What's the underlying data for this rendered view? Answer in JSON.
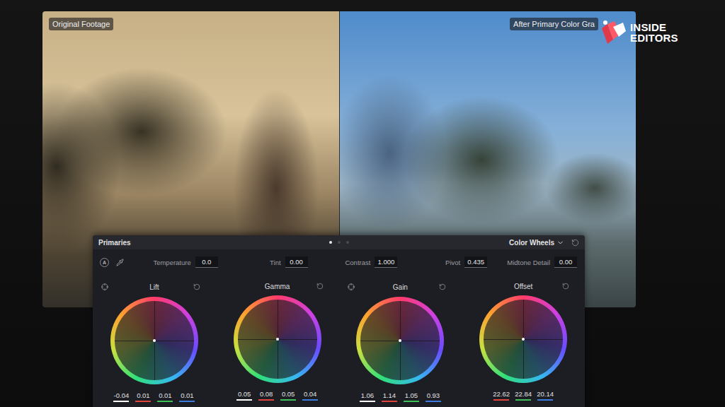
{
  "video": {
    "labels": [
      {
        "text": "Original Footage",
        "side": "before"
      },
      {
        "text": "After Primary Color Gra",
        "side": "after"
      }
    ]
  },
  "logo": {
    "lines": [
      "INSIDE",
      "EDITORS"
    ]
  },
  "panel": {
    "title": "Primaries",
    "pages": [
      {
        "selected": true
      },
      {
        "selected": false
      },
      {
        "selected": false
      }
    ],
    "mode": {
      "label": "Color Wheels"
    },
    "auto_icon": "A",
    "controls": [
      {
        "label": "Temperature",
        "value": "0.0"
      },
      {
        "label": "Tint",
        "value": "0.00"
      },
      {
        "label": "Contrast",
        "value": "1.000"
      },
      {
        "label": "Pivot",
        "value": "0.435"
      },
      {
        "label": "Midtone Detail",
        "value": "0.00"
      }
    ],
    "wheels": [
      {
        "name": "Lift",
        "picker": true,
        "values": [
          {
            "value": "-0.04",
            "color": "#ffffff"
          },
          {
            "value": "0.01",
            "color": "#e0443c"
          },
          {
            "value": "0.01",
            "color": "#3fbf5a"
          },
          {
            "value": "0.01",
            "color": "#3b7be0"
          }
        ]
      },
      {
        "name": "Gamma",
        "picker": false,
        "values": [
          {
            "value": "0.05",
            "color": "#ffffff"
          },
          {
            "value": "0.08",
            "color": "#e0443c"
          },
          {
            "value": "0.05",
            "color": "#3fbf5a"
          },
          {
            "value": "0.04",
            "color": "#3b7be0"
          }
        ]
      },
      {
        "name": "Gain",
        "picker": true,
        "values": [
          {
            "value": "1.06",
            "color": "#ffffff"
          },
          {
            "value": "1.14",
            "color": "#e0443c"
          },
          {
            "value": "1.05",
            "color": "#3fbf5a"
          },
          {
            "value": "0.93",
            "color": "#3b7be0"
          }
        ]
      },
      {
        "name": "Offset",
        "picker": false,
        "values": [
          {
            "value": "22.62",
            "color": "#e0443c"
          },
          {
            "value": "22.84",
            "color": "#3fbf5a"
          },
          {
            "value": "20.14",
            "color": "#3b7be0"
          }
        ]
      }
    ]
  }
}
